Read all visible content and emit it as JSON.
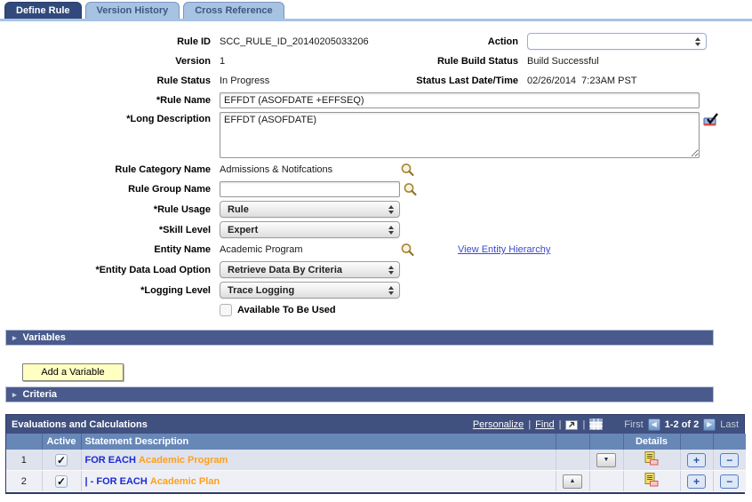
{
  "tabs": [
    {
      "label": "Define Rule",
      "active": true
    },
    {
      "label": "Version History",
      "active": false
    },
    {
      "label": "Cross Reference",
      "active": false
    }
  ],
  "form": {
    "rule_id": {
      "label": "Rule ID",
      "value": "SCC_RULE_ID_20140205033206"
    },
    "action": {
      "label": "Action",
      "value": ""
    },
    "version": {
      "label": "Version",
      "value": "1"
    },
    "rule_build_status": {
      "label": "Rule Build Status",
      "value": "Build Successful"
    },
    "rule_status": {
      "label": "Rule Status",
      "value": "In Progress"
    },
    "status_last": {
      "label": "Status Last Date/Time",
      "value": "02/26/2014  7:23AM PST"
    },
    "rule_name": {
      "label": "*Rule Name",
      "value": "EFFDT (ASOFDATE +EFFSEQ)"
    },
    "long_description": {
      "label": "*Long Description",
      "value": "EFFDT (ASOFDATE)"
    },
    "rule_category": {
      "label": "Rule Category Name",
      "value": "Admissions & Notifcations"
    },
    "rule_group": {
      "label": "Rule Group Name",
      "value": ""
    },
    "rule_usage": {
      "label": "*Rule Usage",
      "value": "Rule"
    },
    "skill_level": {
      "label": "*Skill Level",
      "value": "Expert"
    },
    "entity_name": {
      "label": "Entity Name",
      "value": "Academic Program",
      "link": "View Entity Hierarchy"
    },
    "entity_data_load": {
      "label": "*Entity Data Load Option",
      "value": "Retrieve Data By Criteria"
    },
    "logging_level": {
      "label": "*Logging Level",
      "value": "Trace Logging"
    },
    "available": {
      "label": "Available To Be Used",
      "checked": false
    }
  },
  "sections": {
    "variables": "Variables",
    "criteria": "Criteria",
    "add_variable_button": "Add a Variable"
  },
  "grid": {
    "title": "Evaluations and Calculations",
    "personalize": "Personalize",
    "find": "Find",
    "sep": "|",
    "first": "First",
    "range": "1-2 of 2",
    "last": "Last",
    "columns": {
      "active": "Active",
      "statement": "Statement Description",
      "details": "Details"
    },
    "rows": [
      {
        "num": "1",
        "active": true,
        "prefix": "",
        "keyword": "FOR EACH",
        "entity": "Academic Program"
      },
      {
        "num": "2",
        "active": true,
        "prefix": "| - ",
        "keyword": "FOR EACH",
        "entity": "Academic Plan"
      }
    ]
  },
  "colors": {
    "tab_active": "#32497c",
    "tab_inactive": "#a7c3e2",
    "section_bar": "#4a5a8c",
    "grid_title_bar": "#40507f",
    "grid_header": "#6787b7",
    "row_odd": "#dfe3ee",
    "row_even": "#eef0f6",
    "keyword_blue": "#1b2bd0",
    "entity_orange": "#ff9f1a",
    "link_blue": "#3b49cc"
  }
}
